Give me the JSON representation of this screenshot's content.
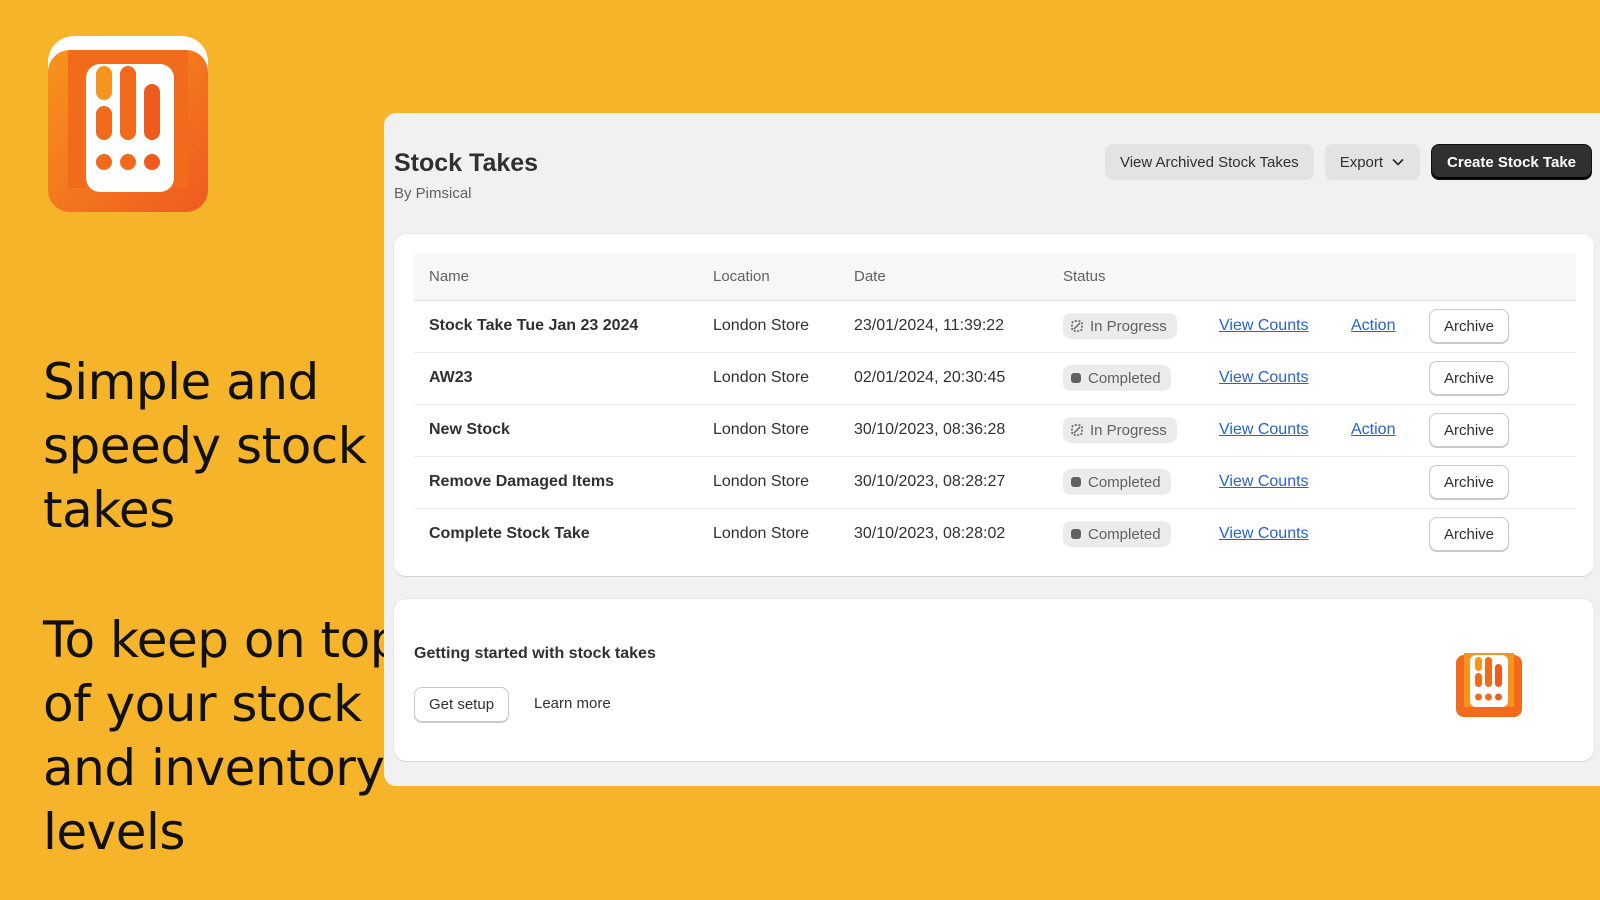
{
  "marketing": {
    "headline": "Simple and speedy stock takes",
    "subline": "To keep on top of your stock and inventory levels"
  },
  "header": {
    "title": "Stock Takes",
    "subtitle": "By Pimsical",
    "view_archived_label": "View Archived Stock Takes",
    "export_label": "Export",
    "create_label": "Create Stock Take"
  },
  "table": {
    "columns": [
      "Name",
      "Location",
      "Date",
      "Status"
    ],
    "rows": [
      {
        "name": "Stock Take Tue Jan 23 2024",
        "location": "London Store",
        "date": "23/01/2024, 11:39:22",
        "status": "In Progress",
        "view": "View Counts",
        "action": "Action",
        "archive": "Archive"
      },
      {
        "name": "AW23",
        "location": "London Store",
        "date": "02/01/2024, 20:30:45",
        "status": "Completed",
        "view": "View Counts",
        "action": "",
        "archive": "Archive"
      },
      {
        "name": "New Stock",
        "location": "London Store",
        "date": "30/10/2023, 08:36:28",
        "status": "In Progress",
        "view": "View Counts",
        "action": "Action",
        "archive": "Archive"
      },
      {
        "name": "Remove Damaged Items",
        "location": "London Store",
        "date": "30/10/2023, 08:28:27",
        "status": "Completed",
        "view": "View Counts",
        "action": "",
        "archive": "Archive"
      },
      {
        "name": "Complete Stock Take",
        "location": "London Store",
        "date": "30/10/2023, 08:28:02",
        "status": "Completed",
        "view": "View Counts",
        "action": "",
        "archive": "Archive"
      }
    ]
  },
  "getting_started": {
    "title": "Getting started with stock takes",
    "setup_label": "Get setup",
    "learn_label": "Learn more"
  },
  "icons": {
    "app_logo": "stock-take-app-logo",
    "export_chevron": "chevron-down-icon",
    "in_progress": "in-progress-icon",
    "completed": "completed-icon"
  },
  "colors": {
    "background": "#F6B42A",
    "brand_orange": "#F26B1D",
    "link": "#2463D1",
    "primary_button": "#303030"
  }
}
